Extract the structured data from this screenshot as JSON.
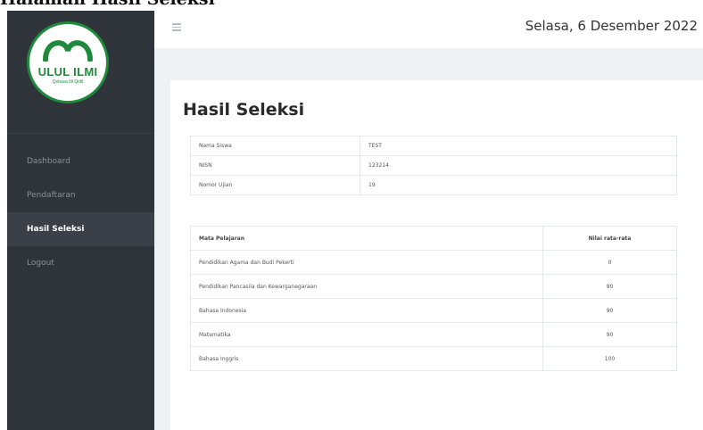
{
  "page_caption": "Halaman Hasil Seleksi",
  "brand": {
    "name": "ULUL ILMI",
    "tagline": "Qoluwa Ilil Qolil",
    "accent_color": "#1f8a3b"
  },
  "sidebar": {
    "items": [
      {
        "label": "Dashboard",
        "active": false
      },
      {
        "label": "Pendaftaran",
        "active": false
      },
      {
        "label": "Hasil Seleksi",
        "active": true
      },
      {
        "label": "Logout",
        "active": false
      }
    ]
  },
  "topbar": {
    "menu_icon": "hamburger-icon",
    "date": "Selasa, 6 Desember 2022"
  },
  "main": {
    "title": "Hasil Seleksi",
    "info": [
      {
        "label": "Nama Siswa",
        "value": "TEST"
      },
      {
        "label": "NISN",
        "value": "123214"
      },
      {
        "label": "Nomor Ujian",
        "value": "19"
      }
    ],
    "scores": {
      "headers": [
        "Mata Pelajaran",
        "Nilai rata-rata"
      ],
      "rows": [
        {
          "subject": "Pendidikan Agama dan Budi Pekerti",
          "value": "0"
        },
        {
          "subject": "Pendidikan Pancasila dan Kewarganegaraan",
          "value": "90"
        },
        {
          "subject": "Bahasa Indonesia",
          "value": "90"
        },
        {
          "subject": "Matematika",
          "value": "90"
        },
        {
          "subject": "Bahasa Inggris",
          "value": "100"
        }
      ]
    }
  }
}
